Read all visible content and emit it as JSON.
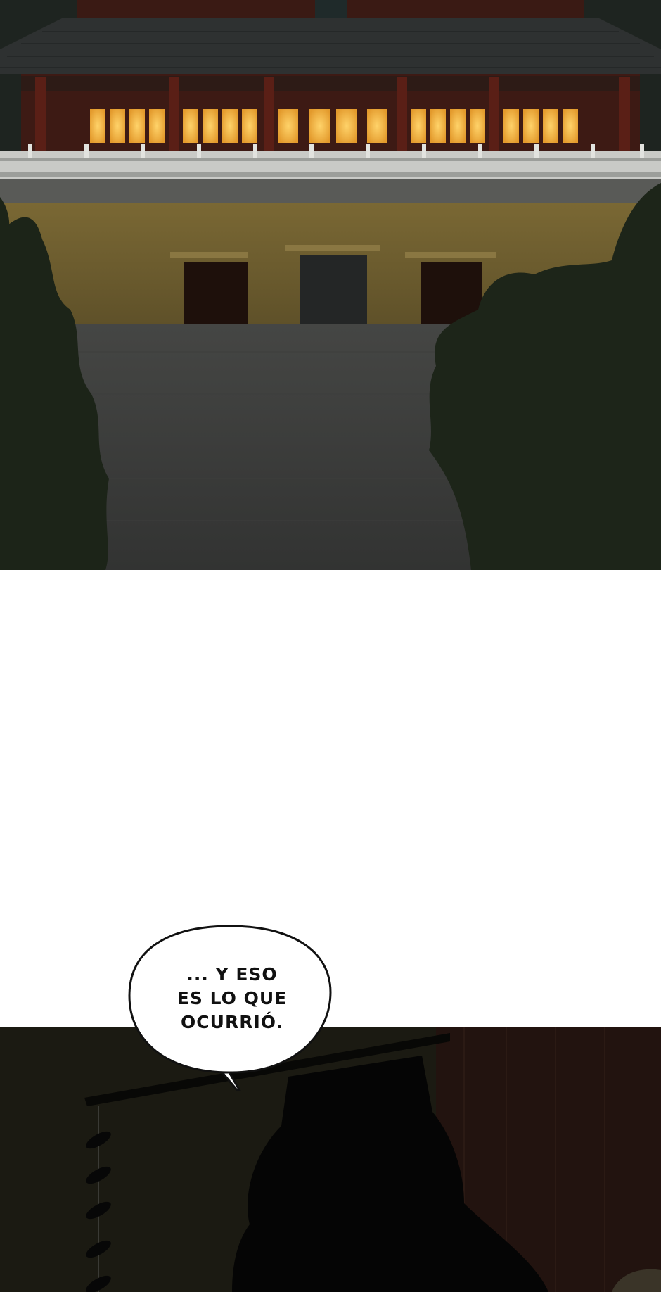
{
  "comic": {
    "panels": [
      {
        "id": "palace-night",
        "description_icon": "palace-icon"
      },
      {
        "id": "silhouette-room",
        "description_icon": "silhouette-icon"
      }
    ],
    "speech_bubble": {
      "lines": [
        "... Y ESO",
        "ES LO QUE",
        "OCURRIÓ."
      ],
      "text": "... Y ESO\nES LO QUE\nOCURRIÓ."
    }
  },
  "colors": {
    "window_glow": "#f5b640",
    "wall": "#7d6a34",
    "roof": "#2e3131",
    "pillar": "#5a1f16",
    "courtyard": "#3b3c3b",
    "tree": "#1c2418",
    "bottom_bg": "#1b1a12"
  }
}
